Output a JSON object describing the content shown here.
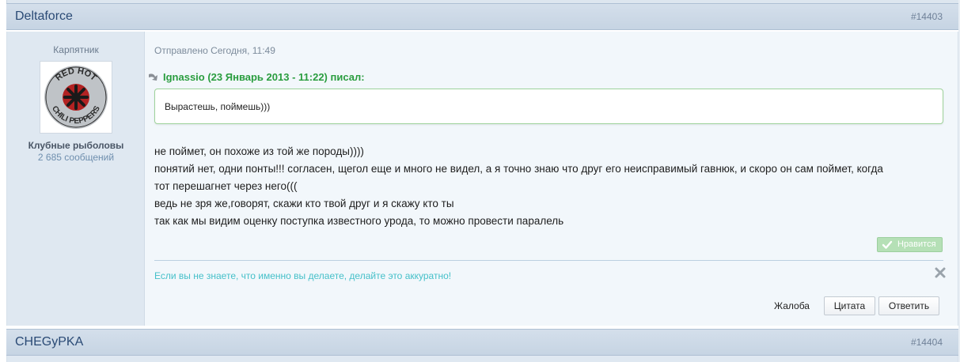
{
  "post": {
    "author": "Deltaforce",
    "number": "#14403",
    "author_title": "Карпятник",
    "group": "Клубные рыболовы",
    "post_count": "2 685 сообщений",
    "sent": "Отправлено Сегодня, 11:49",
    "quote": {
      "citation": "Ignassio (23 Январь 2013 - 11:22) писал:",
      "text": "Вырастешь, поймешь)))"
    },
    "message_lines": [
      "не поймет, он похоже из той же породы))))",
      "понятий нет, одни понты!!! согласен, щегол еще и много не видел, а я точно знаю что друг его неисправимый гавнюк, и скоро он сам поймет, когда",
      "тот перешагнет через него(((",
      "ведь не зря же,говорят, скажи кто твой друг и я скажу кто ты",
      "так как мы видим оценку поступка известного урода, то можно провести паралель"
    ],
    "like_label": "Нравится",
    "signature": "Если вы не знаете, что именно вы делаете, делайте это аккуратно!",
    "report_label": "Жалоба",
    "quote_button": "Цитата",
    "reply_button": "Ответить"
  },
  "next_post": {
    "author": "CHEGyPKA",
    "number": "#14404"
  },
  "avatar": {
    "text_top": "RED HOT",
    "text_bottom": "CHILI PEPPERS"
  },
  "colors": {
    "header_bg": "#c6d4e3",
    "author_link": "#2a4a75",
    "quote_green": "#2a9d3f",
    "signature": "#45c0c9",
    "like_bg": "#b5e0b6"
  }
}
